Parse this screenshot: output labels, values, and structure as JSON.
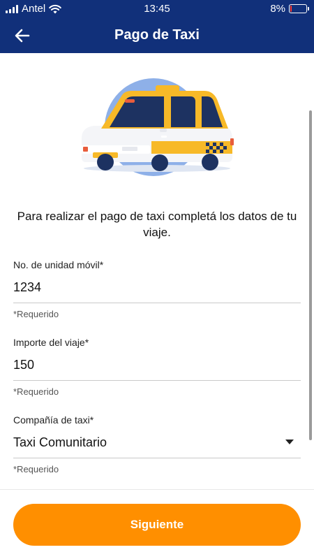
{
  "status_bar": {
    "carrier": "Antel",
    "time": "13:45",
    "battery": "8%",
    "battery_level": 0.08
  },
  "header": {
    "title": "Pago de Taxi"
  },
  "intro_text": "Para realizar el pago de taxi completá los datos de tu viaje.",
  "form": {
    "unit_field": {
      "label": "No. de unidad móvil*",
      "value": "1234",
      "helper": "*Requerido"
    },
    "amount_field": {
      "label": "Importe del viaje*",
      "value": "150",
      "helper": "*Requerido"
    },
    "company_field": {
      "label": "Compañía de taxi*",
      "value": "Taxi Comunitario",
      "helper": "*Requerido"
    }
  },
  "footer": {
    "next_label": "Siguiente"
  },
  "colors": {
    "header_bg": "#11307a",
    "primary_button": "#ff8f00",
    "taxi_yellow": "#f7b928",
    "taxi_navy": "#1d3261",
    "illustration_circle": "#8eb0e8"
  },
  "icons": {
    "back": "arrow-left-icon",
    "wifi": "wifi-icon",
    "signal": "signal-icon",
    "battery": "battery-icon",
    "dropdown": "caret-down-icon"
  }
}
